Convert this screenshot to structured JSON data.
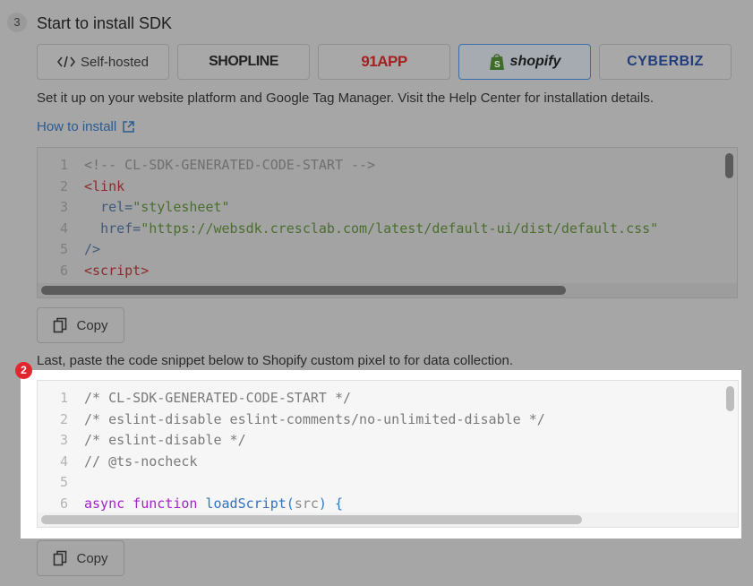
{
  "step": {
    "number": "3",
    "title": "Start to install SDK"
  },
  "platforms": [
    {
      "name": "self-hosted",
      "label": "Self-hosted",
      "icon": "code-icon",
      "active": false
    },
    {
      "name": "shopline",
      "label": "SHOPLINE",
      "active": false
    },
    {
      "name": "91app",
      "label": "91APP",
      "active": false
    },
    {
      "name": "shopify",
      "label": "shopify",
      "icon": "shopify-bag-icon",
      "active": true
    },
    {
      "name": "cyberbiz",
      "label": "CYBERBIZ",
      "active": false
    }
  ],
  "description": "Set it up on your website platform and Google Tag Manager. Visit the Help Center for installation details.",
  "how_to_install": {
    "label": "How to install",
    "icon": "external-link-icon"
  },
  "code1": {
    "line_numbers": [
      "1",
      "2",
      "3",
      "4",
      "5",
      "6"
    ],
    "line1": "<!-- CL-SDK-GENERATED-CODE-START -->",
    "line2_tag": "<link",
    "line3_attr": "rel=",
    "line3_val": "\"stylesheet\"",
    "line4_attr": "href=",
    "line4_val": "\"https://websdk.cresclab.com/latest/default-ui/dist/default.css\"",
    "line5": "/>",
    "line6": "<script>"
  },
  "copy_label": "Copy",
  "instruction": "Last, paste the code snippet below to Shopify custom pixel to for data collection.",
  "marker": "2",
  "code2": {
    "line_numbers": [
      "1",
      "2",
      "3",
      "4",
      "5",
      "6"
    ],
    "line1": "/* CL-SDK-GENERATED-CODE-START */",
    "line2": "/* eslint-disable eslint-comments/no-unlimited-disable */",
    "line3": "/* eslint-disable */",
    "line4": "// @ts-nocheck",
    "line5": "",
    "line6_kw": "async function",
    "line6_fn": "loadScript",
    "line6_param": "src",
    "line6_tail": ") {"
  },
  "colors": {
    "overlay": "#a6a6a6",
    "link": "#2b5b8f",
    "marker": "#e3262d",
    "keyword": "#a224c9",
    "function": "#3072c0"
  }
}
